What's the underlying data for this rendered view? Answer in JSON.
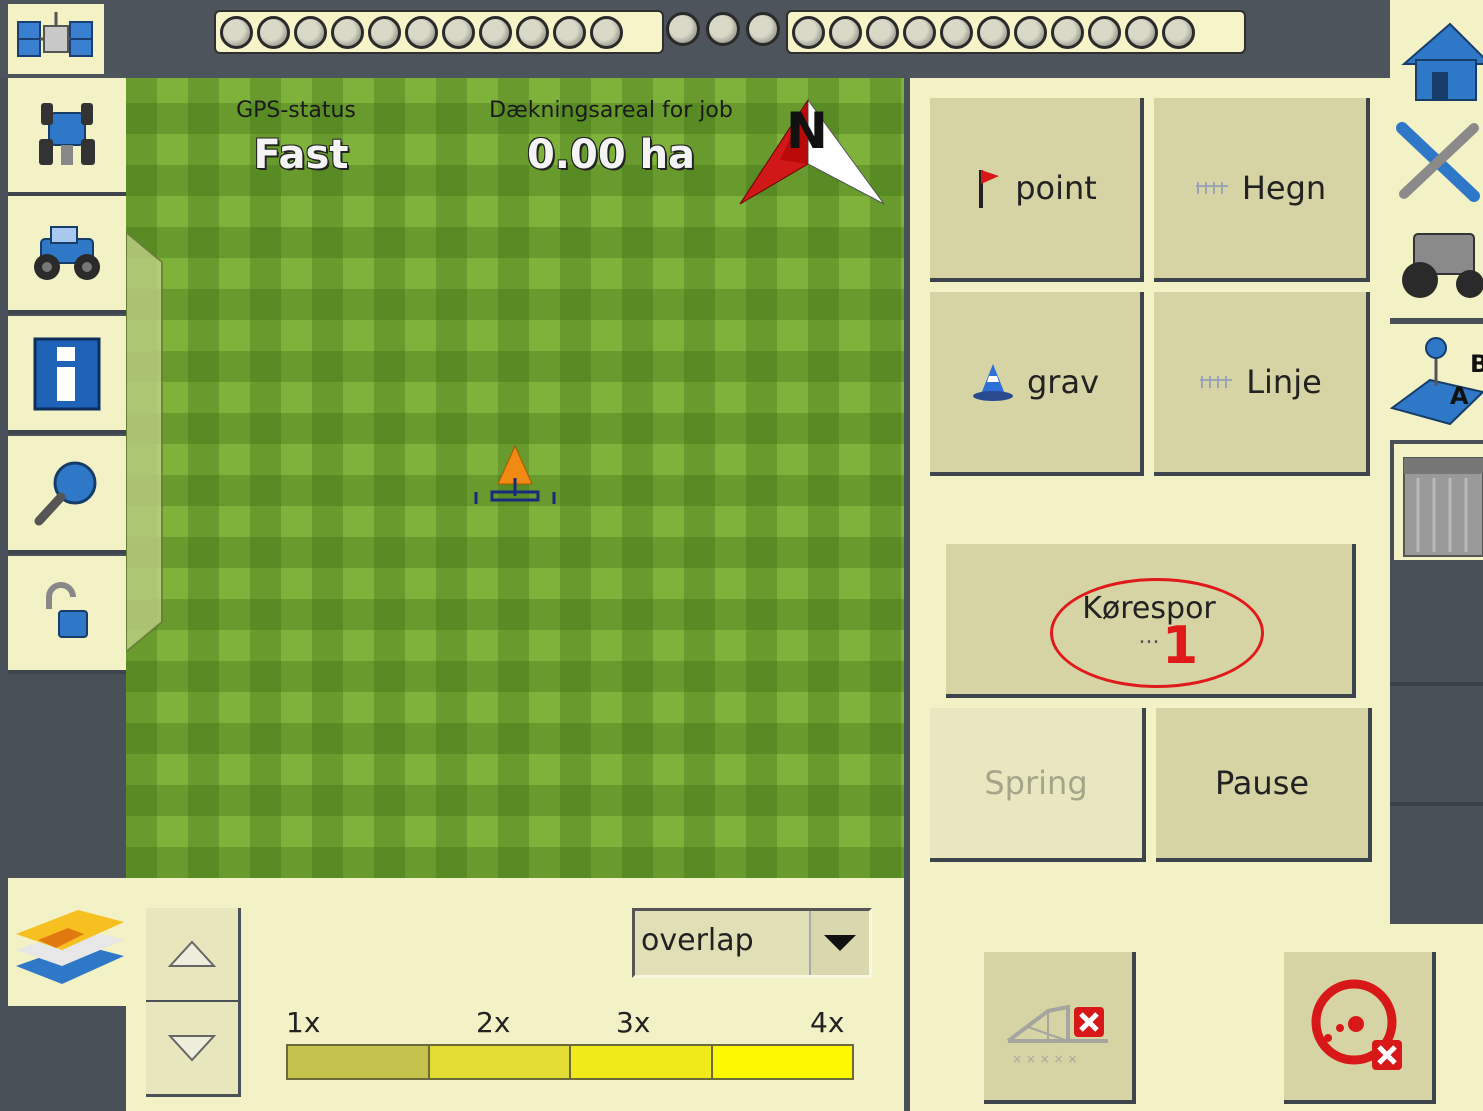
{
  "status_bar": {
    "left_leds": 11,
    "middle_leds": 3,
    "right_leds": 11
  },
  "map": {
    "gps_status_label": "GPS-status",
    "gps_status_value": "Fast",
    "coverage_label": "Dækningsareal for job",
    "coverage_value": "0.00 ha",
    "compass_letter": "N"
  },
  "left_toolbar": {
    "items": [
      "tractor-implement-icon",
      "tractor-icon",
      "info-icon",
      "search-icon",
      "unlock-icon"
    ]
  },
  "bottom_panel": {
    "layer_select": "overlap",
    "scale_labels": [
      "1x",
      "2x",
      "3x",
      "4x"
    ],
    "scale_colors": [
      "#c6c24e",
      "#e2dc34",
      "#f0ea1a",
      "#fcf800"
    ]
  },
  "work_panel": {
    "point_label": "point",
    "hegn_label": "Hegn",
    "grav_label": "grav",
    "linje_label": "Linje",
    "korespor_label": "Kørespor",
    "korespor_sub": "...",
    "spring_label": "Spring",
    "pause_label": "Pause"
  },
  "annotation": {
    "number": "1",
    "color": "#e01a1a"
  },
  "right_toolbar": {
    "items": [
      "home-icon",
      "tools-icon",
      "vehicle-icon",
      "ab-line-icon",
      "sprayer-icon"
    ]
  }
}
